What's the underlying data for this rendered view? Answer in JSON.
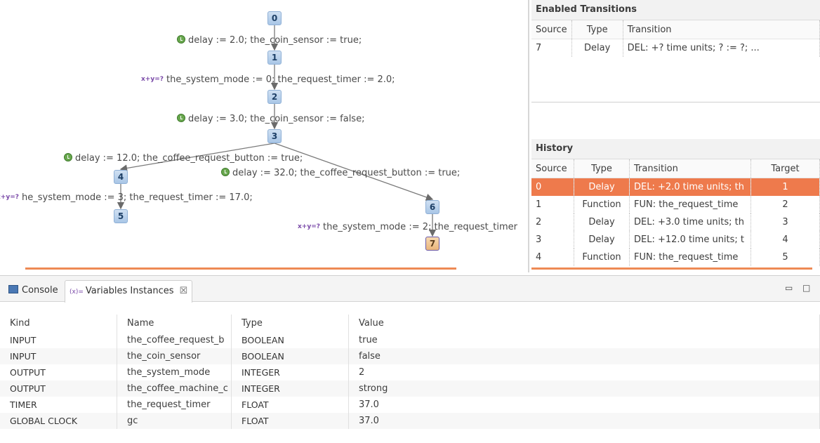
{
  "graph": {
    "nodes": [
      {
        "id": "0",
        "label": "0"
      },
      {
        "id": "1",
        "label": "1"
      },
      {
        "id": "2",
        "label": "2"
      },
      {
        "id": "3",
        "label": "3"
      },
      {
        "id": "4",
        "label": "4"
      },
      {
        "id": "5",
        "label": "5"
      },
      {
        "id": "6",
        "label": "6"
      },
      {
        "id": "7",
        "label": "7",
        "current": true
      }
    ],
    "edges": [
      {
        "from": "0",
        "to": "1",
        "kind": "delay",
        "label": "delay := 2.0; the_coin_sensor := true;"
      },
      {
        "from": "1",
        "to": "2",
        "kind": "function",
        "label": "the_system_mode := 0; the_request_timer := 2.0;"
      },
      {
        "from": "2",
        "to": "3",
        "kind": "delay",
        "label": "delay := 3.0; the_coin_sensor := false;"
      },
      {
        "from": "3",
        "to": "4",
        "kind": "delay",
        "label": "delay := 12.0; the_coffee_request_button := true;"
      },
      {
        "from": "3",
        "to": "6",
        "kind": "delay",
        "label": "delay := 32.0; the_coffee_request_button := true;"
      },
      {
        "from": "4",
        "to": "5",
        "kind": "function",
        "label": "he_system_mode := 3; the_request_timer := 17.0;"
      },
      {
        "from": "6",
        "to": "7",
        "kind": "function",
        "label": "the_system_mode := 2; the_request_timer"
      }
    ],
    "icons": {
      "delay": "clock-icon",
      "function": "function-icon"
    },
    "function_glyph": "x+y\n=?"
  },
  "enabled": {
    "title": "Enabled Transitions",
    "columns": [
      "Source",
      "Type",
      "Transition"
    ],
    "rows": [
      {
        "source": "7",
        "type": "Delay",
        "transition": "DEL: +? time units; ? := ?; ..."
      }
    ]
  },
  "history": {
    "title": "History",
    "columns": [
      "Source",
      "Type",
      "Transition",
      "Target"
    ],
    "rows": [
      {
        "source": "0",
        "type": "Delay",
        "transition": "DEL: +2.0 time units; th",
        "target": "1",
        "selected": true
      },
      {
        "source": "1",
        "type": "Function",
        "transition": "FUN: the_request_time",
        "target": "2"
      },
      {
        "source": "2",
        "type": "Delay",
        "transition": "DEL: +3.0 time units; th",
        "target": "3"
      },
      {
        "source": "3",
        "type": "Delay",
        "transition": "DEL: +12.0 time units; t",
        "target": "4"
      },
      {
        "source": "4",
        "type": "Function",
        "transition": "FUN: the_request_time",
        "target": "5"
      }
    ]
  },
  "bottom": {
    "tabs": [
      {
        "label": "Console",
        "icon": "console-icon"
      },
      {
        "label": "Variables Instances",
        "icon": "variables-icon",
        "active": true,
        "icon_text": "(x)="
      }
    ],
    "close_glyph": "☒",
    "minimize_glyph": "▭",
    "maximize_glyph": "□",
    "columns": [
      "Kind",
      "Name",
      "Type",
      "Value"
    ],
    "rows": [
      {
        "kind": "INPUT",
        "name": "the_coffee_request_b",
        "type": "BOOLEAN",
        "value": "true"
      },
      {
        "kind": "INPUT",
        "name": "the_coin_sensor",
        "type": "BOOLEAN",
        "value": "false"
      },
      {
        "kind": "OUTPUT",
        "name": "the_system_mode",
        "type": "INTEGER",
        "value": "2"
      },
      {
        "kind": "OUTPUT",
        "name": "the_coffee_machine_c",
        "type": "INTEGER",
        "value": "strong"
      },
      {
        "kind": "TIMER",
        "name": "the_request_timer",
        "type": "FLOAT",
        "value": "37.0"
      },
      {
        "kind": "GLOBAL CLOCK",
        "name": "gc",
        "type": "FLOAT",
        "value": "37.0"
      }
    ]
  },
  "colors": {
    "selection": "#ee7a4c",
    "node": "#b9d1ee",
    "current_node": "#eab57a",
    "accent_line": "#ee8a55"
  }
}
